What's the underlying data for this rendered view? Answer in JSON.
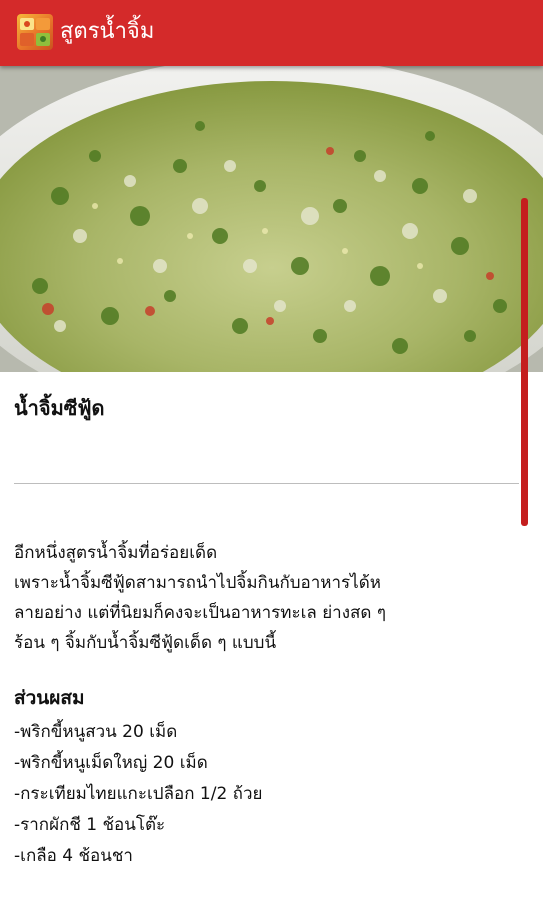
{
  "app": {
    "title": "สูตรน้ำจิ้ม",
    "icon": "app-logo-icon",
    "bar_color": "#d42a2a"
  },
  "hero": {
    "icon": "food-photo",
    "description_visible": false
  },
  "recipe": {
    "title": "น้ำจิ้มซีฟู้ด",
    "description_lines": [
      "อีกหนึ่งสูตรน้ำจิ้มที่อร่อยเด็ด",
      "เพราะน้ำจิ้มซีฟู้ดสามารถนำไปจิ้มกินกับอาหารได้ห",
      "ลายอย่าง แต่ที่นิยมก็คงจะเป็นอาหารทะเล ย่างสด ๆ",
      "ร้อน ๆ จิ้มกับน้ำจิ้มซีฟู้ดเด็ด ๆ แบบนี้"
    ],
    "ingredients_heading": "ส่วนผสม",
    "ingredients": [
      "-พริกขี้หนูสวน 20 เม็ด",
      "-พริกขี้หนูเม็ดใหญ่ 20 เม็ด",
      "-กระเทียมไทยแกะเปลือก 1/2 ถ้วย",
      "-รากผักชี 1 ช้อนโต๊ะ",
      "-เกลือ 4 ช้อนชา"
    ]
  },
  "scrollbar_color": "#c41e1e"
}
